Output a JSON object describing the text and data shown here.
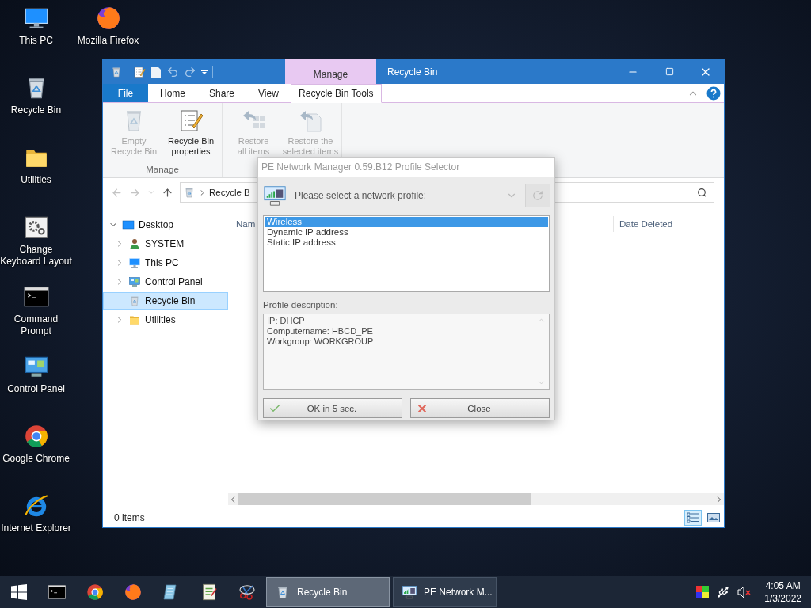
{
  "desktop_icons": [
    {
      "label": "This PC",
      "kind": "pc"
    },
    {
      "label": "Recycle Bin",
      "kind": "recycle"
    },
    {
      "label": "Utilities",
      "kind": "folder"
    },
    {
      "label": "Change Keyboard Layout",
      "kind": "keyboard"
    },
    {
      "label": "Command Prompt",
      "kind": "cmd"
    },
    {
      "label": "Control Panel",
      "kind": "control"
    },
    {
      "label": "Google Chrome",
      "kind": "chrome"
    },
    {
      "label": "Internet Explorer",
      "kind": "ie"
    },
    {
      "label": "Mozilla Firefox",
      "kind": "firefox"
    }
  ],
  "explorer": {
    "title": "Recycle Bin",
    "contextual_tab": "Manage",
    "ribbon_tabs": [
      {
        "label": "File",
        "kind": "file",
        "selected": false
      },
      {
        "label": "Home",
        "kind": "tab",
        "selected": false
      },
      {
        "label": "Share",
        "kind": "tab",
        "selected": false
      },
      {
        "label": "View",
        "kind": "tab",
        "selected": false
      },
      {
        "label": "Recycle Bin Tools",
        "kind": "tab",
        "selected": true
      }
    ],
    "ribbon_groups": [
      {
        "label": "Manage",
        "buttons": [
          {
            "label": "Empty Recycle Bin",
            "kind": "empty",
            "disabled": true
          },
          {
            "label": "Recycle Bin properties",
            "kind": "properties",
            "disabled": false
          }
        ]
      },
      {
        "buttons": [
          {
            "label": "Restore all items",
            "kind": "restore-all",
            "disabled": true
          },
          {
            "label": "Restore the selected items",
            "kind": "restore-selected",
            "disabled": true
          }
        ]
      }
    ],
    "address": "Recycle B",
    "tree": [
      {
        "label": "Desktop",
        "kind": "desktop",
        "expandable": true,
        "expanded": true,
        "selected": false,
        "children": [
          {
            "label": "SYSTEM",
            "kind": "user",
            "expandable": true,
            "expanded": false,
            "selected": false
          },
          {
            "label": "This PC",
            "kind": "pc",
            "expandable": true,
            "expanded": false,
            "selected": false
          },
          {
            "label": "Control Panel",
            "kind": "control",
            "expandable": true,
            "expanded": false,
            "selected": false
          },
          {
            "label": "Recycle Bin",
            "kind": "recycle",
            "expandable": false,
            "selected": true
          },
          {
            "label": "Utilities",
            "kind": "folder",
            "expandable": true,
            "expanded": false,
            "selected": false
          }
        ]
      }
    ],
    "columns": [
      "Nam",
      "Date Deleted"
    ],
    "status": "0 items"
  },
  "dialog": {
    "title": "PE Network Manager 0.59.B12 Profile Selector",
    "prompt": "Please select a network profile:",
    "profiles": [
      {
        "label": "Wireless",
        "selected": true
      },
      {
        "label": "Dynamic IP address",
        "selected": false
      },
      {
        "label": "Static IP address",
        "selected": false
      }
    ],
    "description_label": "Profile description:",
    "description": [
      "IP: DHCP",
      "Computername: HBCD_PE",
      "Workgroup: WORKGROUP"
    ],
    "buttons": [
      {
        "label": "OK in 5 sec.",
        "kind": "ok"
      },
      {
        "label": "Close",
        "kind": "close"
      }
    ]
  },
  "taskbar": {
    "pinned": [
      {
        "kind": "cmd"
      },
      {
        "kind": "chrome"
      },
      {
        "kind": "firefox"
      },
      {
        "kind": "doc"
      },
      {
        "kind": "edit"
      },
      {
        "kind": "scissors"
      }
    ],
    "tasks": [
      {
        "label": "Recycle Bin",
        "kind": "recycle",
        "selected": true
      },
      {
        "label": "PE Network M...",
        "kind": "network",
        "selected": false
      }
    ],
    "volume_muted": true,
    "time": "4:05 AM",
    "date": "1/3/2022"
  }
}
